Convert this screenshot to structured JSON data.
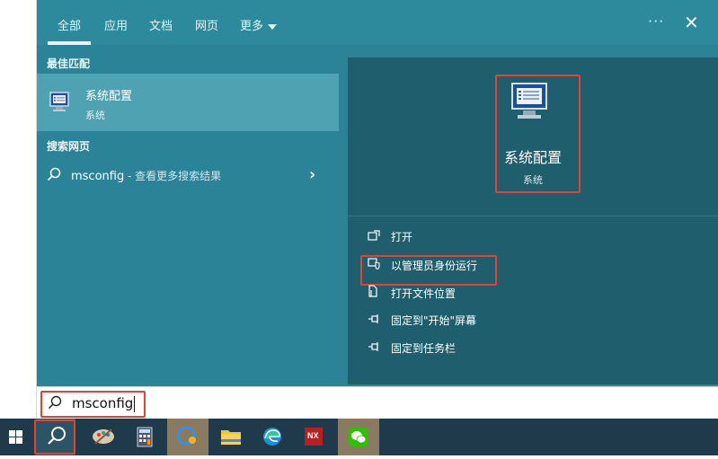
{
  "tabs": [
    {
      "label": "全部"
    },
    {
      "label": "应用"
    },
    {
      "label": "文档"
    },
    {
      "label": "网页"
    },
    {
      "label": "更多"
    }
  ],
  "window_controls": {
    "more_label": "···",
    "close_label": "✕"
  },
  "left": {
    "best_match_header": "最佳匹配",
    "best_match": {
      "title": "系统配置",
      "subtitle": "系统"
    },
    "web_header": "搜索网页",
    "web_result": {
      "query": "msconfig",
      "suffix": " - 查看更多搜索结果",
      "chevron": "›"
    }
  },
  "preview": {
    "title": "系统配置",
    "subtitle": "系统",
    "actions": [
      {
        "label": "打开",
        "icon": "open-icon"
      },
      {
        "label": "以管理员身份运行",
        "icon": "shield-icon"
      },
      {
        "label": "打开文件位置",
        "icon": "file-location-icon"
      },
      {
        "label": "固定到\"开始\"屏幕",
        "icon": "pin-icon"
      },
      {
        "label": "固定到任务栏",
        "icon": "pin-icon"
      }
    ]
  },
  "search": {
    "value": "msconfig"
  },
  "taskbar": {
    "items": [
      {
        "name": "start-button",
        "icon": "windows-logo-icon"
      },
      {
        "name": "search-button",
        "icon": "search-icon"
      },
      {
        "name": "app-paint",
        "icon": "paint-icon"
      },
      {
        "name": "app-calculator",
        "icon": "calculator-icon"
      },
      {
        "name": "app-chat",
        "icon": "chat-icon"
      },
      {
        "name": "app-file-explorer",
        "icon": "folder-icon"
      },
      {
        "name": "app-edge",
        "icon": "edge-icon"
      },
      {
        "name": "app-nx",
        "icon": "nx-icon",
        "label": "NX"
      },
      {
        "name": "app-wechat",
        "icon": "wechat-icon"
      }
    ]
  },
  "colors": {
    "accent": "#2c8396",
    "highlight": "#4fa2b1",
    "preview_bg": "#1f5e6c",
    "annotation_red": "#e8412d"
  }
}
